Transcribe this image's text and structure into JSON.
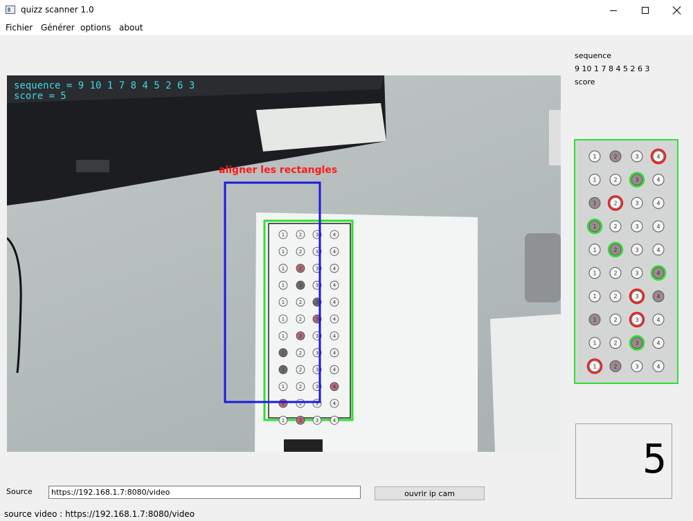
{
  "window": {
    "title": "quizz scanner 1.0"
  },
  "menu": {
    "items": [
      "Fichier",
      "Générer",
      "options",
      "about"
    ]
  },
  "video": {
    "overlay_sequence": "sequence = 9 10 1 7 8 4 5 2 6 3",
    "overlay_score": "score = 5",
    "align_hint": "aligner les rectangles",
    "sheet_numbers": [
      "1",
      "2",
      "3",
      "4"
    ],
    "marked": [
      [
        2,
        1,
        "r"
      ],
      [
        3,
        1,
        "g"
      ],
      [
        4,
        2,
        "g"
      ],
      [
        5,
        2,
        "r"
      ],
      [
        6,
        1,
        "r"
      ],
      [
        7,
        0,
        "g"
      ],
      [
        8,
        0,
        "g"
      ],
      [
        9,
        3,
        "r"
      ],
      [
        10,
        0,
        "r"
      ],
      [
        11,
        1,
        "r"
      ]
    ],
    "colors": {
      "sequence_text": "#40d6e6",
      "align_text": "#ff1a1a",
      "align_rect": "#1a1adf",
      "sheet_rect": "#2ee02e"
    }
  },
  "right_panel": {
    "sequence_label": "sequence",
    "sequence_value": "9 10 1 7 8 4 5 2 6 3",
    "score_label": "score",
    "answers": [
      {
        "marked": 1,
        "circle": 3,
        "status": "wrong"
      },
      {
        "marked": 2,
        "circle": 2,
        "status": "correct"
      },
      {
        "marked": 0,
        "circle": 1,
        "status": "wrong"
      },
      {
        "marked": 0,
        "circle": 0,
        "status": "correct"
      },
      {
        "marked": 1,
        "circle": 1,
        "status": "correct"
      },
      {
        "marked": 3,
        "circle": 3,
        "status": "correct"
      },
      {
        "marked": 3,
        "circle": 2,
        "status": "wrong"
      },
      {
        "marked": 0,
        "circle": 2,
        "status": "wrong"
      },
      {
        "marked": 2,
        "circle": 2,
        "status": "correct"
      },
      {
        "marked": 1,
        "circle": 0,
        "status": "wrong"
      }
    ],
    "colors": {
      "correct": "#2ee02e",
      "wrong": "#ee1c1c",
      "filled": "#9c8a8e"
    }
  },
  "score_display": {
    "value": "5"
  },
  "source": {
    "label": "Source",
    "value": "https://192.168.1.7:8080/video",
    "button_label": "ouvrir ip cam"
  },
  "status": {
    "text": "source video : https://192.168.1.7:8080/video"
  }
}
